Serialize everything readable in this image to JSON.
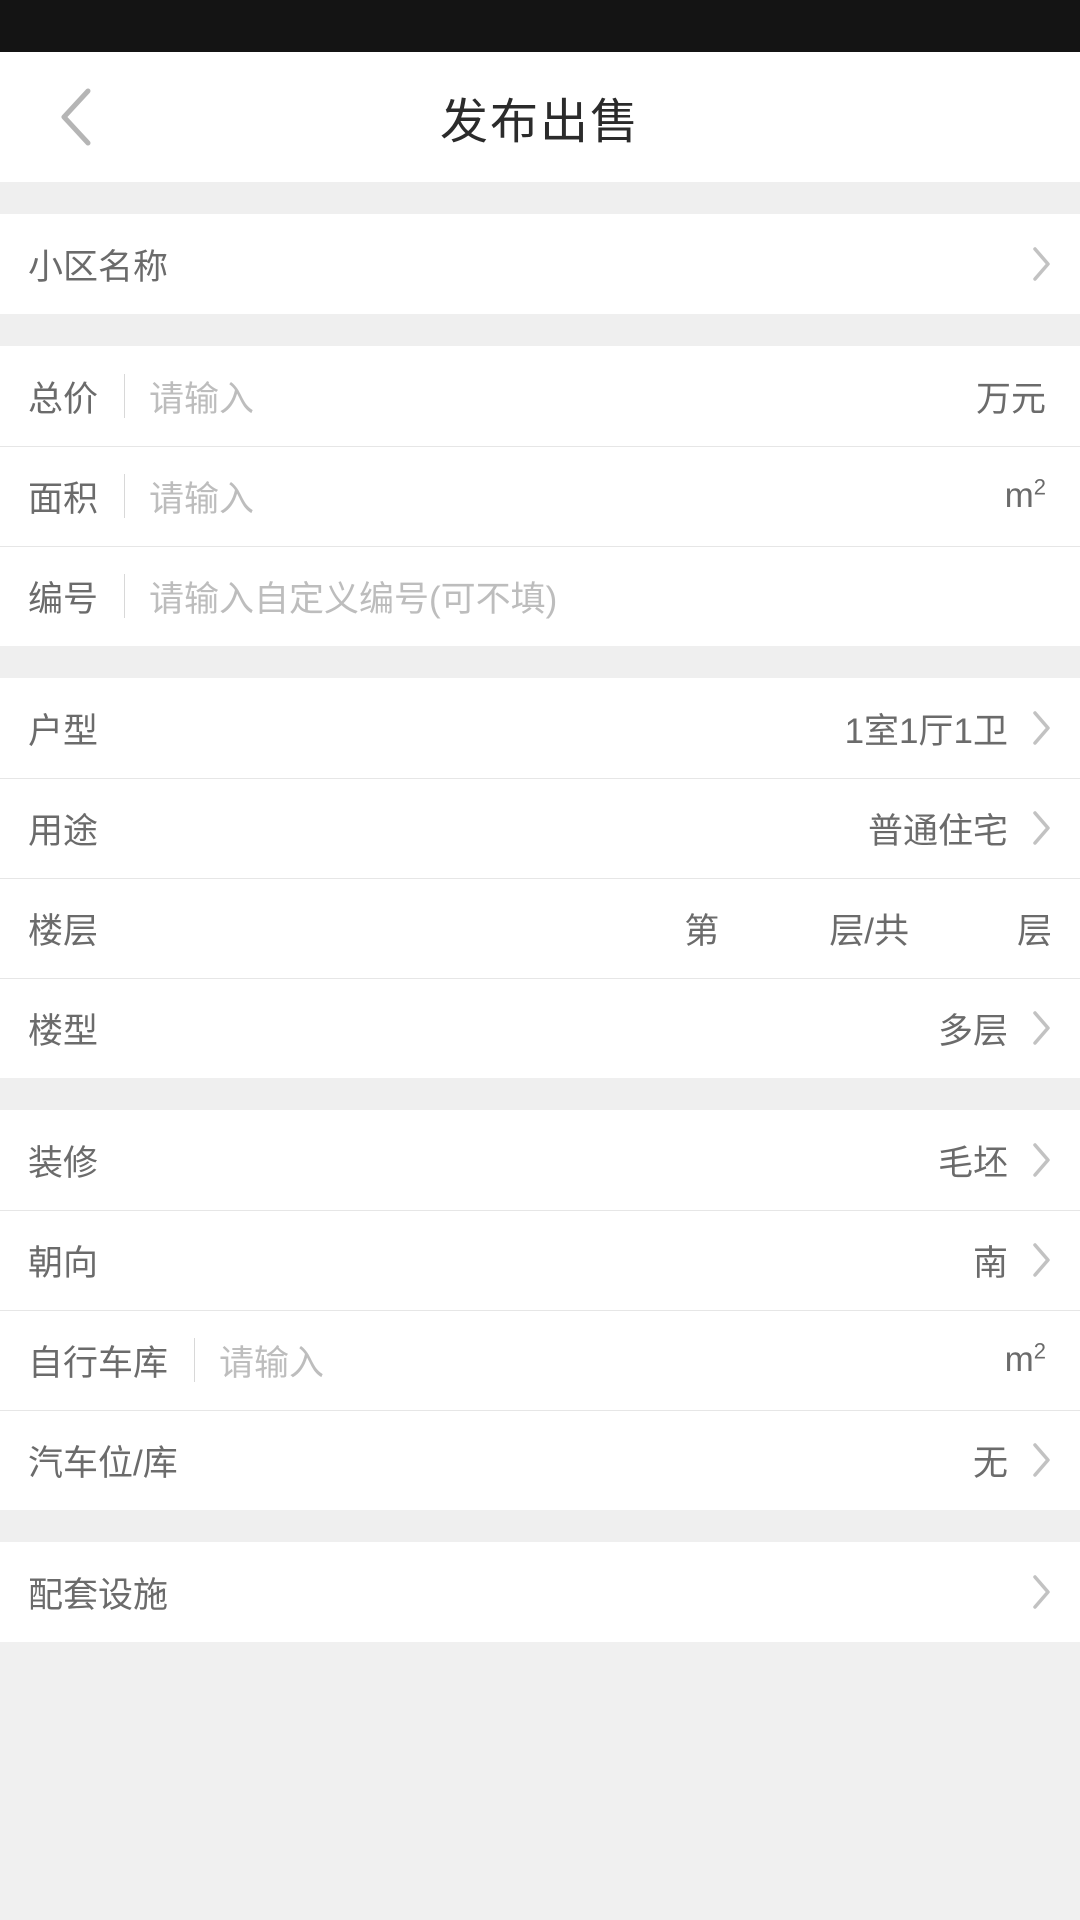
{
  "header": {
    "title": "发布出售",
    "back_icon": "chevron-left-icon"
  },
  "sections": [
    {
      "id": "community",
      "rows": [
        {
          "type": "nav",
          "label": "小区名称",
          "value": "",
          "chevron_icon": "chevron-right-icon"
        }
      ]
    },
    {
      "id": "basics",
      "rows": [
        {
          "type": "input",
          "label": "总价",
          "placeholder": "请输入",
          "value": "",
          "unit": "万元"
        },
        {
          "type": "input",
          "label": "面积",
          "placeholder": "请输入",
          "value": "",
          "unit": "m",
          "unit_sup": "2"
        },
        {
          "type": "input",
          "label": "编号",
          "placeholder": "请输入自定义编号(可不填)",
          "value": "",
          "unit": ""
        }
      ]
    },
    {
      "id": "layout",
      "rows": [
        {
          "type": "nav",
          "label": "户型",
          "value": "1室1厅1卫",
          "chevron_icon": "chevron-right-icon"
        },
        {
          "type": "nav",
          "label": "用途",
          "value": "普通住宅",
          "chevron_icon": "chevron-right-icon"
        },
        {
          "type": "floor",
          "label": "楼层",
          "prefix_word": "第",
          "middle_word": "层/共",
          "suffix_word": "层",
          "floor_value": "",
          "total_value": ""
        },
        {
          "type": "nav",
          "label": "楼型",
          "value": "多层",
          "chevron_icon": "chevron-right-icon"
        }
      ]
    },
    {
      "id": "details",
      "rows": [
        {
          "type": "nav",
          "label": "装修",
          "value": "毛坯",
          "chevron_icon": "chevron-right-icon"
        },
        {
          "type": "nav",
          "label": "朝向",
          "value": "南",
          "chevron_icon": "chevron-right-icon"
        },
        {
          "type": "input",
          "label": "自行车库",
          "placeholder": "请输入",
          "value": "",
          "unit": "m",
          "unit_sup": "2"
        },
        {
          "type": "nav",
          "label": "汽车位/库",
          "value": "无",
          "chevron_icon": "chevron-right-icon"
        }
      ]
    },
    {
      "id": "facilities",
      "rows": [
        {
          "type": "nav",
          "label": "配套设施",
          "value": "",
          "chevron_icon": "chevron-right-icon"
        }
      ]
    }
  ],
  "colors": {
    "status_bar": "#141414",
    "row_background": "#ffffff",
    "section_gap": "#efefef",
    "label_text": "#6b6b6b",
    "placeholder_text": "#bdbdbd",
    "divider": "#e6e6e6",
    "title_text": "#2b2b2b",
    "chevron": "#bdbdbd"
  }
}
